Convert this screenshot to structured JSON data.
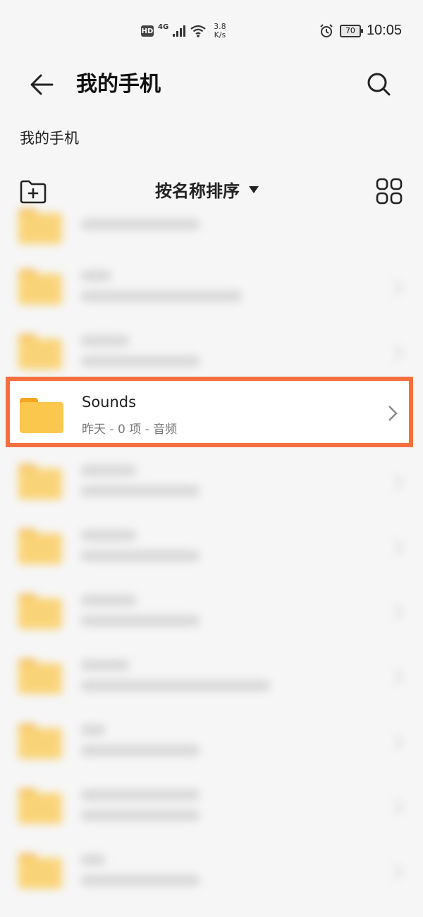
{
  "status_bar": {
    "hd": "HD",
    "network": "4G",
    "speed_value": "3.8",
    "speed_unit": "K/s",
    "battery": "70",
    "time": "10:05"
  },
  "header": {
    "title": "我的手机"
  },
  "breadcrumb": "我的手机",
  "toolbar": {
    "sort_label": "按名称排序"
  },
  "list": {
    "selected_item": {
      "name": "Sounds",
      "meta": "昨天 - 0 项 - 音频"
    }
  },
  "colors": {
    "folder": "#fbc84d",
    "folder_tab": "#f5a623",
    "highlight": "#f56f3f"
  }
}
